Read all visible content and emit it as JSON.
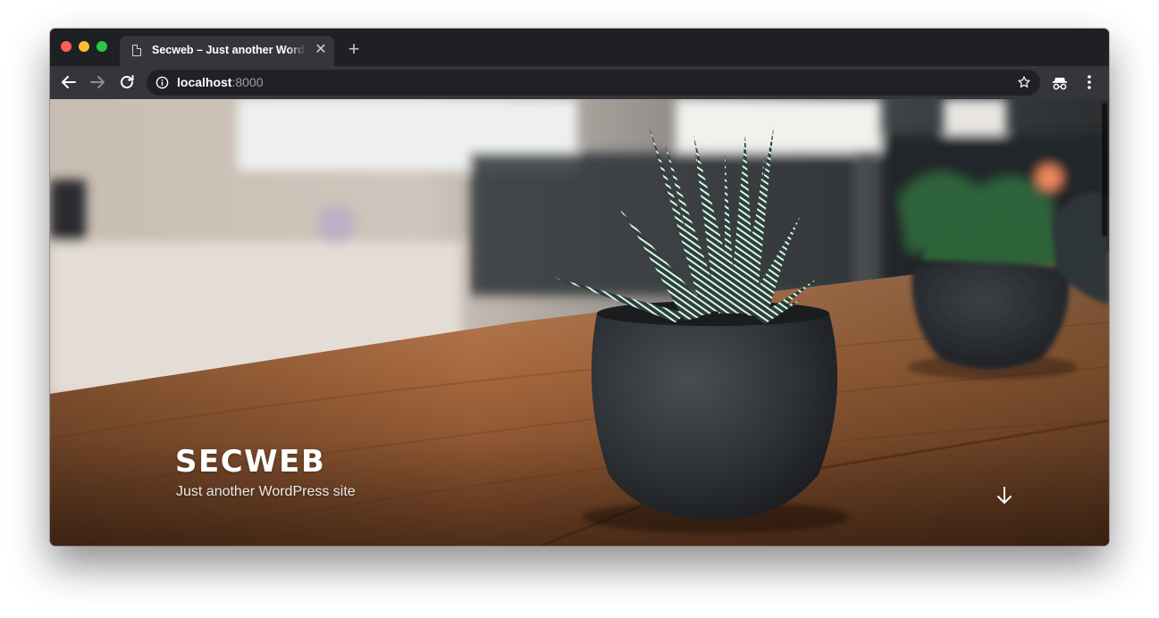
{
  "browser": {
    "tab": {
      "title": "Secweb – Just another WordPress site",
      "icon": "page-icon",
      "close_icon": "close-icon"
    },
    "new_tab_icon": "plus-icon",
    "nav": {
      "back_icon": "arrow-left-icon",
      "forward_icon": "arrow-right-icon",
      "reload_icon": "reload-icon"
    },
    "omnibox": {
      "security_icon": "info-icon",
      "host": "localhost",
      "port": ":8000",
      "bookmark_icon": "star-icon"
    },
    "toolbar_right": {
      "incognito_icon": "incognito-icon",
      "menu_icon": "kebab-menu-icon"
    }
  },
  "page": {
    "site_title": "SECWEB",
    "site_description": "Just another WordPress site",
    "scroll_icon": "arrow-down-icon",
    "hero_image": "potted succulent plant on wooden table"
  },
  "colors": {
    "titlebar": "#1f2023",
    "toolbar": "#35363a",
    "omnibox": "#202124",
    "traffic_red": "#fe5f57",
    "traffic_yellow": "#febc2e",
    "traffic_green": "#28c840"
  }
}
